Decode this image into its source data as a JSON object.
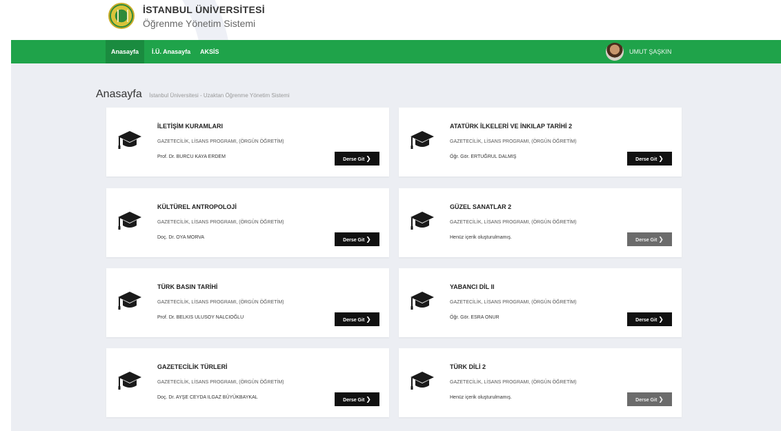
{
  "header": {
    "title": "İSTANBUL ÜNİVERSİTESİ",
    "subtitle": "Öğrenme Yönetim Sistemi"
  },
  "nav": {
    "items": [
      {
        "label": "Anasayfa"
      },
      {
        "label": "İ.Ü. Anasayfa"
      },
      {
        "label": "AKSİS"
      }
    ],
    "user_name": "UMUT ŞAŞKIN"
  },
  "page": {
    "title": "Anasayfa",
    "breadcrumb": "İstanbul Üniversitesi - Uzaktan Öğrenme Yönetim Sistemi"
  },
  "courses": [
    {
      "title": "İLETİŞİM KURAMLARI",
      "program": "GAZETECİLİK, LİSANS PROGRAMI, (ÖRGÜN ÖĞRETİM)",
      "teacher": "Prof. Dr. BURCU KAYA ERDEM",
      "button": "Derse Git",
      "enabled": true
    },
    {
      "title": "ATATÜRK İLKELERİ VE İNKILAP TARİHİ 2",
      "program": "GAZETECİLİK, LİSANS PROGRAMI, (ÖRGÜN ÖĞRETİM)",
      "teacher": "Öğr. Gör. ERTUĞRUL DALMIŞ",
      "button": "Derse Git",
      "enabled": true
    },
    {
      "title": "KÜLTÜREL ANTROPOLOJİ",
      "program": "GAZETECİLİK, LİSANS PROGRAMI, (ÖRGÜN ÖĞRETİM)",
      "teacher": "Doç. Dr. OYA MORVA",
      "button": "Derse Git",
      "enabled": true
    },
    {
      "title": "GÜZEL SANATLAR 2",
      "program": "GAZETECİLİK, LİSANS PROGRAMI, (ÖRGÜN ÖĞRETİM)",
      "teacher": "Henüz içerik oluşturulmamış.",
      "button": "Derse Git",
      "enabled": false
    },
    {
      "title": "TÜRK BASIN TARİHİ",
      "program": "GAZETECİLİK, LİSANS PROGRAMI, (ÖRGÜN ÖĞRETİM)",
      "teacher": "Prof. Dr. BELKIS ULUSOY NALCIOĞLU",
      "button": "Derse Git",
      "enabled": true
    },
    {
      "title": "YABANCI DİL II",
      "program": "GAZETECİLİK, LİSANS PROGRAMI, (ÖRGÜN ÖĞRETİM)",
      "teacher": "Öğr. Gör. ESRA ONUR",
      "button": "Derse Git",
      "enabled": true
    },
    {
      "title": "GAZETECİLİK TÜRLERİ",
      "program": "GAZETECİLİK, LİSANS PROGRAMI, (ÖRGÜN ÖĞRETİM)",
      "teacher": "Doç. Dr. AYŞE CEYDA ILGAZ BÜYÜKBAYKAL",
      "button": "Derse Git",
      "enabled": true
    },
    {
      "title": "TÜRK DİLİ 2",
      "program": "GAZETECİLİK, LİSANS PROGRAMI, (ÖRGÜN ÖĞRETİM)",
      "teacher": "Henüz içerik oluşturulmamış.",
      "button": "Derse Git",
      "enabled": false
    }
  ],
  "colors": {
    "nav_green": "#1fa34a",
    "button_dark": "#111111",
    "button_disabled": "#6b6b6b"
  },
  "icons": {
    "course": "graduation-cap-icon",
    "button_arrow": "chevron-right-icon"
  }
}
